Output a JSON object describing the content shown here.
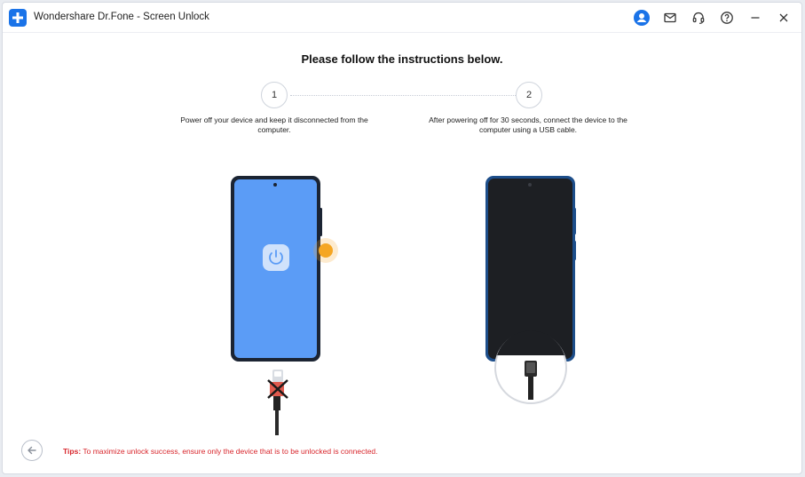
{
  "window": {
    "title": "Wondershare Dr.Fone - Screen Unlock"
  },
  "titlebar_icons": [
    "account-icon",
    "mail-icon",
    "headset-icon",
    "help-icon",
    "minimize-icon",
    "close-icon"
  ],
  "main": {
    "heading": "Please follow the instructions below.",
    "steps": [
      {
        "number": "1",
        "text": "Power off your device and keep it disconnected from the computer."
      },
      {
        "number": "2",
        "text": "After powering off for 30 seconds, connect the device to the computer using a USB cable."
      }
    ]
  },
  "footer": {
    "tips_label": "Tips:",
    "tips_text": " To maximize unlock success, ensure only the device that is to be unlocked is connected."
  },
  "colors": {
    "accent": "#1a73e8",
    "phone_on": "#5b9cf6",
    "phone_off": "#1d1f23",
    "power_indicator": "#f5a623",
    "tips": "#d8262c"
  }
}
